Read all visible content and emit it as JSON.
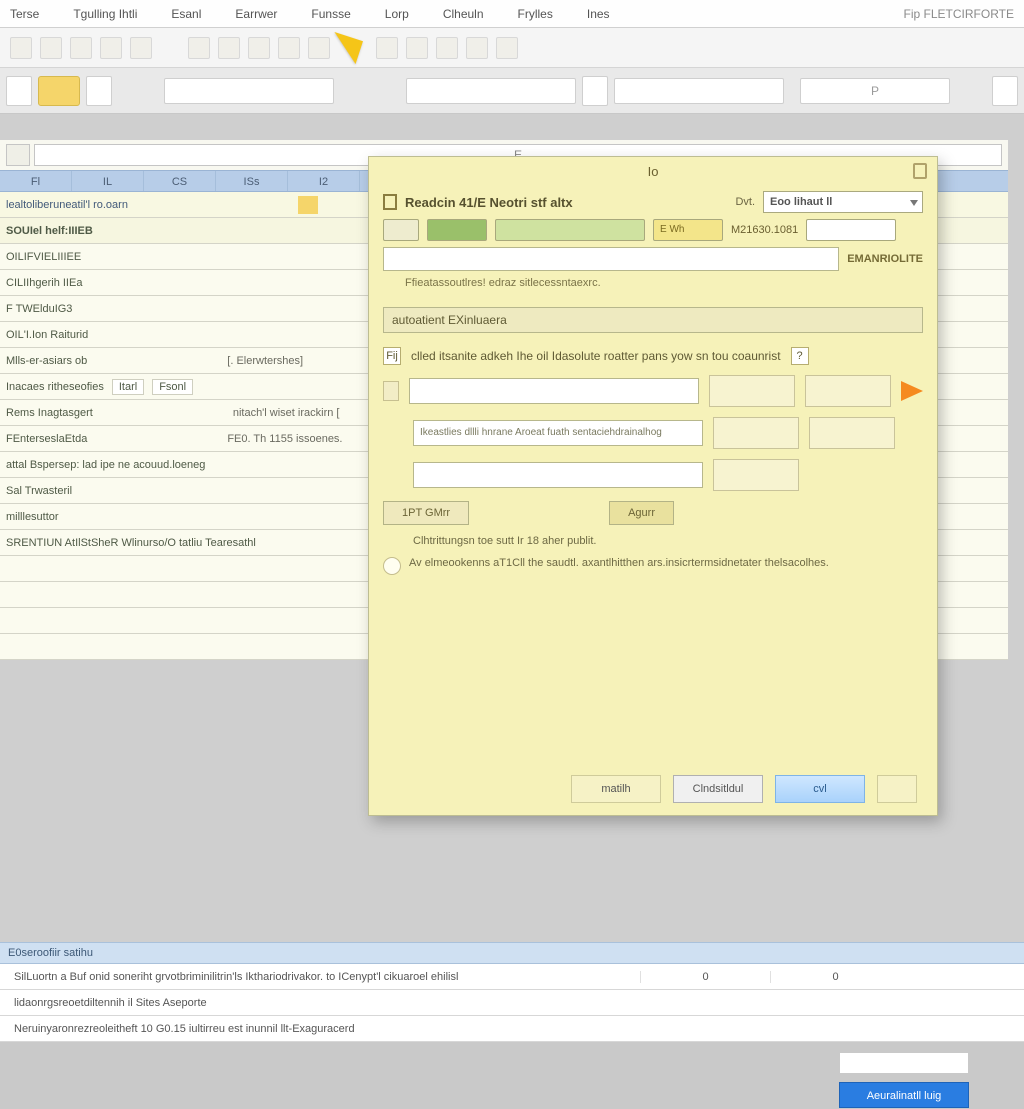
{
  "menu": {
    "items": [
      "Terse",
      "Tgulling  Ihtli",
      "Esanl",
      "Earrwer",
      "Funsse",
      "Lorp",
      "Clheuln",
      "Frylles",
      "Ines"
    ],
    "far": "Fip FLETCIRFORTE"
  },
  "ribbon": {
    "wide_label": "P"
  },
  "sheet": {
    "formula_label": "E",
    "col_headers": [
      "Fl",
      "IL",
      "CS",
      "ISs",
      "I2"
    ],
    "title_row": "lealtoliberuneatil'l ro.oarn",
    "rows": [
      "SOUIel helf:IIIEB",
      "OILIFVIELIIIEE",
      "CILIIhgerih IIEa",
      "F TWElduIG3",
      "OIL'I.Ion Raiturid",
      "Mlls-er-asiars ob",
      "Inacaes ritheseofies",
      "Rems Inagtasgert",
      "FEnterseslaEtda",
      "attal Bspersep: lad ipe ne acouud.loeneg",
      "Sal Trwasteril",
      "milllesuttor",
      "SRENTIUN AtIlStSheR Wlinurso/O tatliu Tearesathl"
    ],
    "row5_sub": "[. Elerwtershes]",
    "row6_badges": [
      "Itarl",
      "Fsonl"
    ],
    "row7_sub": "nitach'l wiset irackirn  [",
    "row8_sub": "FE0. Th 1155  issoenes."
  },
  "bottom": {
    "header": "E0seroofiir satihu",
    "rows": [
      {
        "c1": "SilLuortn a Buf onid soneriht grvotbriminilitrin'ls Ikthariodrivakor. to ICenypt'l cikuaroel ehilisl",
        "c2": "0",
        "c3": "0"
      },
      {
        "c1": "lidaonrgsreoetdiltennih il Sites Aseporte",
        "c2": "",
        "c3": ""
      },
      {
        "c1": "Neruinyaronrezreoleitheft 10 G0.15 iultirreu est inunnil llt-Exaguracerd",
        "c2": "",
        "c3": ""
      }
    ],
    "blue_button": "Aeuralinatll luig"
  },
  "dialog": {
    "title": "Io",
    "heading": "Readcin 41/E  Neotri stf altx",
    "ext_lbl": "Dvt.",
    "combo_value": "Eoo lihaut ll",
    "row1_lbl1": "E Wh",
    "row1_lbl2": "M21630.1081",
    "side_label": "EMANRIOLITE",
    "hint1": "Ffieatassoutlres!    edraz sitlecessntaexrc.",
    "group_title": "autoatient EXinluaera",
    "prompt_q": "Fij",
    "prompt_text": "clled itsanite adkeh Ihe oil Idasolute roatter pans yow  sn tou coaunrist",
    "field2_text": "Ikeastlies dllli hnrane Aroeat fuath sentaciehdrainalhog",
    "btn_igmr": "1PT GMrr",
    "btn_apply": "Agurr",
    "note1": "Clhtrittungsn toe sutt Ir 18 aher publit.",
    "note2": "Av elmeookenns   aT1Cll the saudtl.  axantlhitthen ars.insicrtermsidnetater thelsacolhes.",
    "footer": {
      "left": "matilh",
      "mid": "Clndsitldul",
      "ok": "cvl"
    }
  }
}
